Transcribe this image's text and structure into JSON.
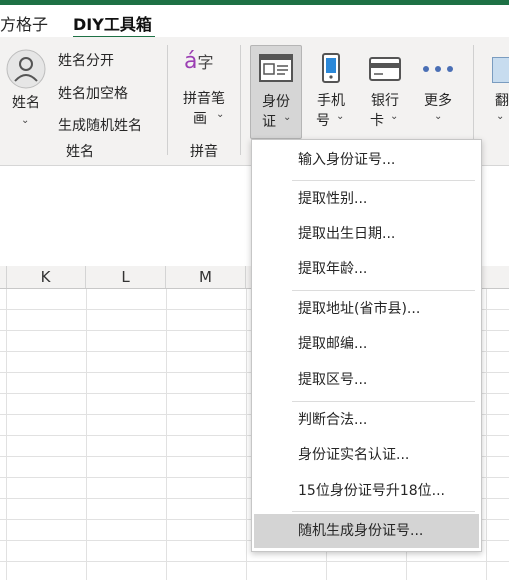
{
  "tabs": [
    {
      "label": "方格子"
    },
    {
      "label": "DIY工具箱"
    }
  ],
  "ribbon": {
    "name_group": {
      "big_button": "姓名",
      "split": "姓名分开",
      "add_space": "姓名加空格",
      "random": "生成随机姓名",
      "label": "姓名"
    },
    "pinyin_group": {
      "button_line1": "拼音笔",
      "button_line2": "画",
      "label": "拼音"
    },
    "id_button": {
      "line1": "身份",
      "line2": "证"
    },
    "phone_button": {
      "line1": "手机",
      "line2": "号"
    },
    "bank_button": {
      "line1": "银行",
      "line2": "卡"
    },
    "more_button": {
      "line1": "更多"
    },
    "translate_button": {
      "line1": "翻"
    }
  },
  "columns": [
    "K",
    "L",
    "M"
  ],
  "id_menu": {
    "items": [
      "输入身份证号...",
      "提取性别...",
      "提取出生日期...",
      "提取年龄...",
      "提取地址(省市县)...",
      "提取邮编...",
      "提取区号...",
      "判断合法...",
      "身份证实名认证...",
      "15位身份证号升18位...",
      "随机生成身份证号..."
    ],
    "highlighted": "随机生成身份证号..."
  },
  "colors": {
    "accent": "#1e7145",
    "ribbon_bg": "#f3f2f1",
    "highlight": "#d4d4d4",
    "pinyin_purple": "#9b3fb3"
  }
}
